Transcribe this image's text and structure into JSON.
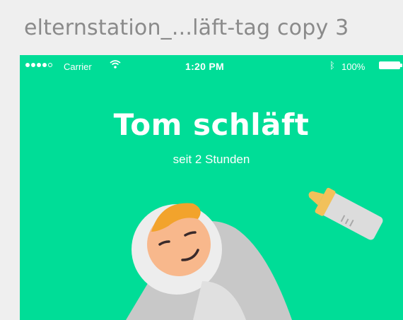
{
  "artboard": {
    "title": "elternstation_...läft-tag copy 3"
  },
  "status_bar": {
    "carrier": "Carrier",
    "time": "1:20 PM",
    "battery": "100%"
  },
  "main": {
    "headline": "Tom schläft",
    "subline": "seit 2 Stunden"
  },
  "icons": {
    "baby": "sleeping-baby-icon",
    "bottle": "baby-bottle-icon"
  },
  "colors": {
    "background": "#00dd97",
    "text": "#ffffff",
    "canvas": "#efefef",
    "title_text": "#8a8a8a"
  }
}
